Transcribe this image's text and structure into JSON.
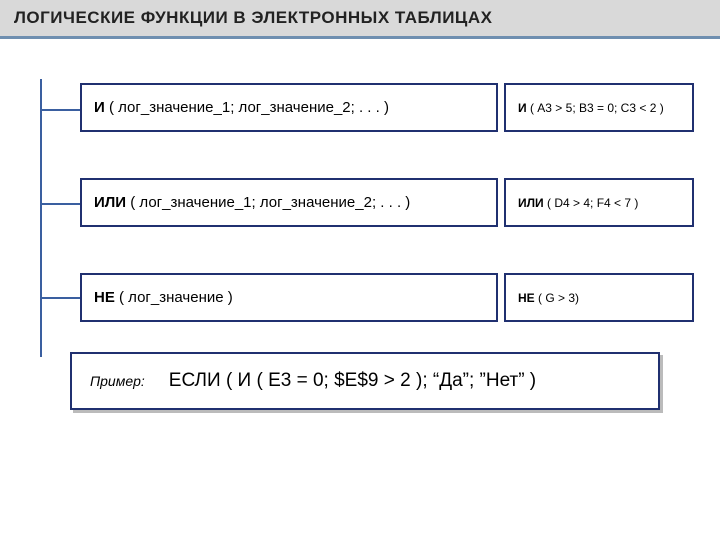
{
  "title": "ЛОГИЧЕСКИЕ  ФУНКЦИИ  В  ЭЛЕКТРОННЫХ  ТАБЛИЦАХ",
  "rows": [
    {
      "fn": "И",
      "syntax": " ( лог_значение_1; лог_значение_2; . . . )",
      "ex_fn": "И",
      "ex": " ( A3 > 5; B3 = 0; C3 <  2 )"
    },
    {
      "fn": "ИЛИ",
      "syntax": " ( лог_значение_1; лог_значение_2; . . . )",
      "ex_fn": "ИЛИ",
      "ex": " ( D4 > 4; F4 < 7 )"
    },
    {
      "fn": "НЕ",
      "syntax": " ( лог_значение )",
      "ex_fn": "НЕ",
      "ex": " ( G > 3)"
    }
  ],
  "example": {
    "label": "Пример:",
    "text": "ЕСЛИ ( И ( E3 = 0; $E$9 > 2 ); “Да”; ”Нет” )"
  }
}
